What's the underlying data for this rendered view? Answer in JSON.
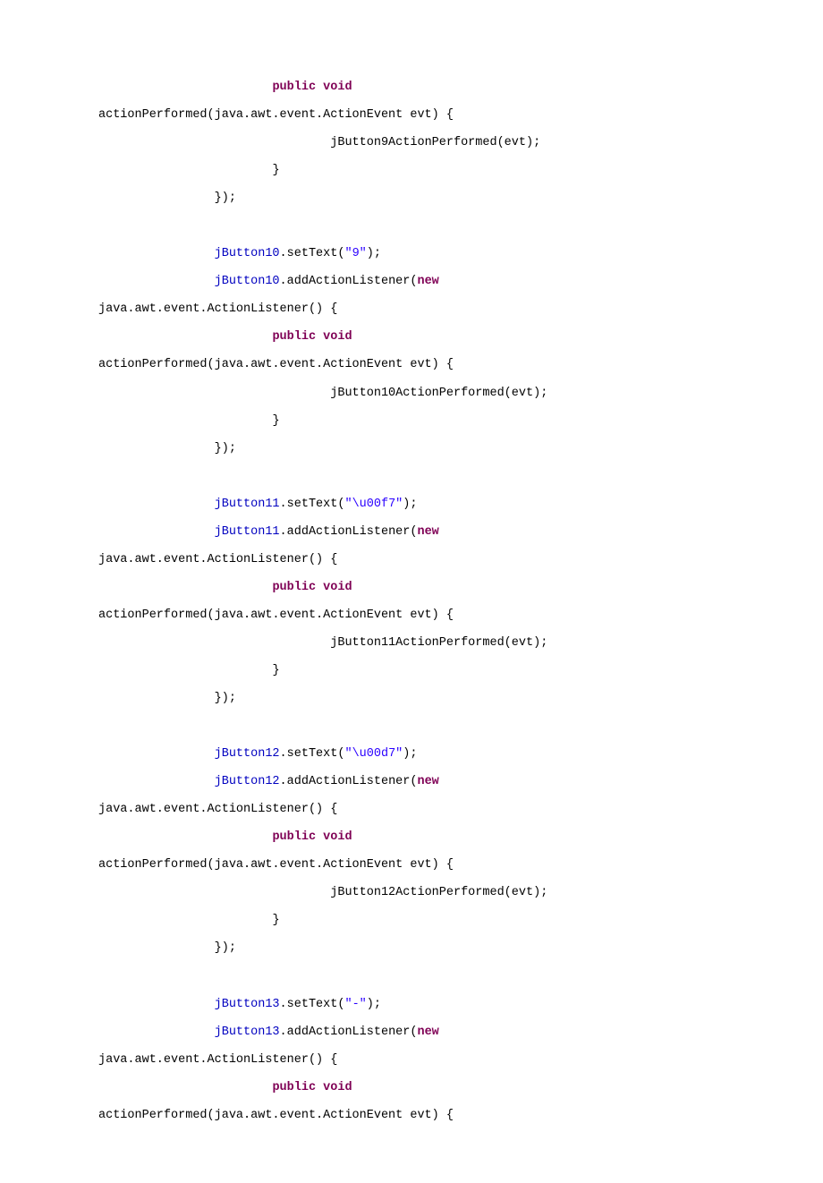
{
  "code": {
    "indent8": "        ",
    "indent12": "            ",
    "indent16": "                ",
    "indent24": "                        ",
    "indent32": "                                ",
    "kw_public": "public",
    "kw_void": "void",
    "kw_new": "new",
    "actionPerformed_open": "actionPerformed(java.awt.event.ActionEvent evt) {",
    "actionListener_open": "java.awt.event.ActionListener() {",
    "close_brace": "}",
    "close_listener": "});",
    "dot_setText_open": ".setText(",
    "dot_addActionListener_open": ".addActionListener(",
    "close_paren_semi": ");",
    "fld_jButton10": "jButton10",
    "fld_jButton11": "jButton11",
    "fld_jButton12": "jButton12",
    "fld_jButton13": "jButton13",
    "str_9": "\"9\"",
    "str_div": "\"\\u00f7\"",
    "str_mul": "\"\\u00d7\"",
    "str_minus": "\"-\"",
    "call_jButton9": "jButton9ActionPerformed(evt);",
    "call_jButton10": "jButton10ActionPerformed(evt);",
    "call_jButton11": "jButton11ActionPerformed(evt);",
    "call_jButton12": "jButton12ActionPerformed(evt);"
  }
}
